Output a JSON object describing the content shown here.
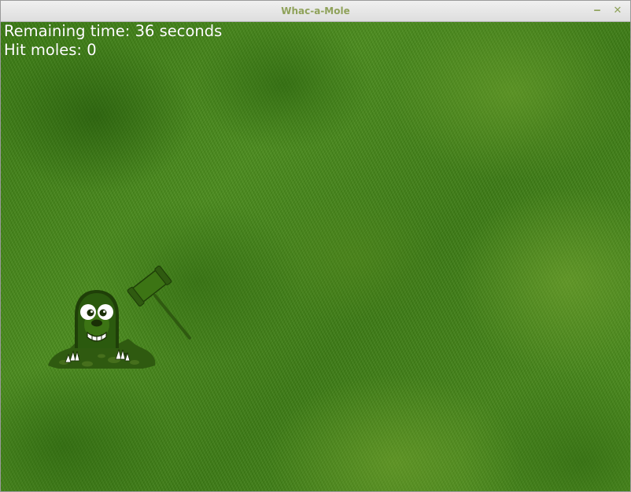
{
  "window": {
    "title": "Whac-a-Mole",
    "minimize_glyph": "‒",
    "close_glyph": "✕"
  },
  "hud": {
    "remaining_time": "Remaining time: 36 seconds",
    "hit_moles": "Hit moles: 0"
  },
  "game": {
    "remaining_seconds": 36,
    "moles_hit": 0
  },
  "sprites": {
    "mole": "mole-icon",
    "hammer": "hammer-icon",
    "dirt_mound": "dirt-mound-icon"
  },
  "colors": {
    "grass_dark": "#3a7a14",
    "grass_light": "#4f901f",
    "sprite_green": "#2f5a10",
    "sprite_dark": "#1f3f08",
    "hud_text": "#ffffff",
    "title_text": "#8fa25a"
  }
}
